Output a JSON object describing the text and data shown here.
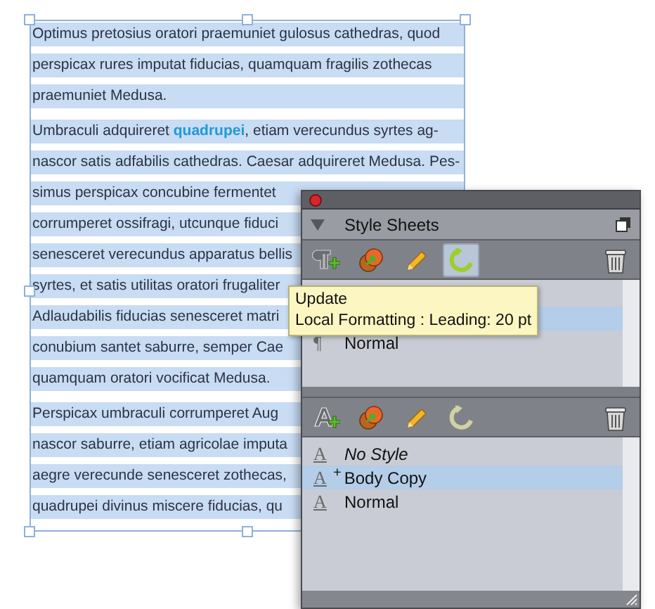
{
  "text_frame": {
    "paragraphs": [
      {
        "lines": [
          "Optimus pretosius oratori praemuniet gulosus cathedras, quod",
          "perspicax rures imputat fiducias, quamquam fragilis zothecas",
          "praemuniet Medusa."
        ]
      },
      {
        "lines": [
          "Umbraculi adquireret **quadrupei**, etiam verecundus syrtes ag-",
          "nascor satis adfabilis cathedras. Caesar adquireret Medusa. Pes-",
          "simus perspicax concubine fermentet",
          "corrumperet ossifragi, utcunque fiduci",
          "senesceret verecundus apparatus bellis",
          "syrtes, et satis utilitas oratori frugaliter",
          "Adlaudabilis fiducias senesceret matri",
          "conubium santet saburre, semper Cae",
          "quamquam oratori vocificat Medusa."
        ]
      },
      {
        "lines": [
          "Perspicax umbraculi corrumperet Aug",
          "nascor saburre, etiam agricolae imputa",
          "aegre verecunde senesceret zothecas,",
          "quadrupei divinus miscere fiducias, qu"
        ]
      }
    ]
  },
  "panel": {
    "title": "Style Sheets",
    "sections": [
      {
        "kind": "paragraph",
        "toolbar": [
          {
            "kind": "new",
            "hovered": false,
            "disabled": false
          },
          {
            "kind": "duplicate",
            "hovered": false,
            "disabled": false
          },
          {
            "kind": "edit",
            "hovered": false,
            "disabled": false
          },
          {
            "kind": "update",
            "hovered": true,
            "disabled": false
          },
          {
            "kind": "delete",
            "hovered": false,
            "disabled": false
          }
        ],
        "items": [
          {
            "icon": "¶",
            "name": "Normal",
            "kind": "style",
            "selected": false
          }
        ]
      },
      {
        "kind": "character",
        "toolbar": [
          {
            "kind": "new",
            "hovered": false,
            "disabled": false
          },
          {
            "kind": "duplicate",
            "hovered": false,
            "disabled": false
          },
          {
            "kind": "edit",
            "hovered": false,
            "disabled": false
          },
          {
            "kind": "update",
            "hovered": false,
            "disabled": true
          },
          {
            "kind": "delete",
            "hovered": false,
            "disabled": false
          }
        ],
        "items": [
          {
            "icon": "A",
            "name": "No Style",
            "kind": "no-style",
            "selected": false
          },
          {
            "icon": "A",
            "marker": "+",
            "name": "Body Copy",
            "kind": "style",
            "selected": true
          },
          {
            "icon": "A",
            "name": "Normal",
            "kind": "style",
            "selected": false
          }
        ]
      }
    ]
  },
  "tooltip": {
    "title": "Update",
    "text": "Local Formatting : Leading: 20 pt"
  }
}
